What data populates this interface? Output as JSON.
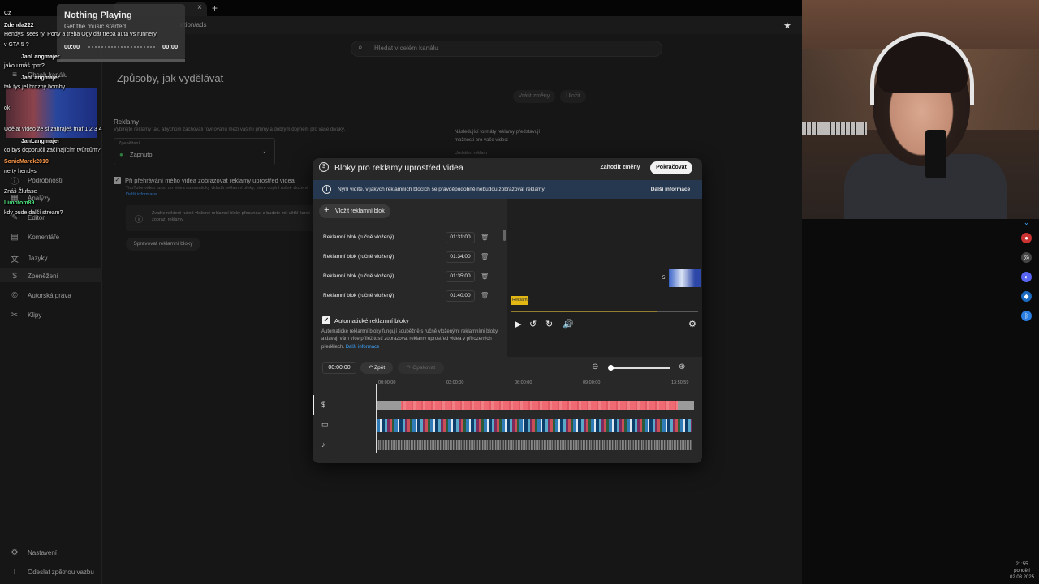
{
  "browser": {
    "tab_close": "×",
    "tab_new": "+",
    "url_fragment": "ation/ads",
    "star": "★"
  },
  "studio": {
    "search_placeholder": "Hledat v celém kanálu",
    "page_title": "Způsoby, jak vydělávat",
    "cancel_label": "Vrátit změny",
    "save_label": "Uložit",
    "ads_heading": "Reklamy",
    "ads_desc": "Vybírejte reklamy tak, abychom zachovali rovnováhu mezi vašimi příjmy a dobrým dojmem pro vaše diváky.",
    "ads_select_label": "Zpeněžení",
    "ads_select_value": "Zapnuto",
    "midroll_label": "Při přehrávání mého videa zobrazovat reklamy uprostřed videa",
    "midroll_desc": "YouTube video turbo do videa automaticky vkládá reklamní bloky, které doplní ručně vložené",
    "midroll_more": "Další informace",
    "notice_text": "Zvažte některé ručně vložené reklamní bloky přesunout a budete mít větší šanci zobrazí reklamy",
    "manage_label": "Spravovat reklamní bloky",
    "right_info_text": "Následující formáty reklamy představují možnosti pro vaše video:",
    "right_info_sub": "Umístění reklam",
    "sidebar": [
      {
        "icon": "≡",
        "label": "Obsah kanálu"
      },
      {
        "icon": "ⓘ",
        "label": "Podrobnosti"
      },
      {
        "icon": "▦",
        "label": "Analýzy"
      },
      {
        "icon": "✎",
        "label": "Editor"
      },
      {
        "icon": "▤",
        "label": "Komentáře"
      },
      {
        "icon": "文",
        "label": "Jazyky"
      },
      {
        "icon": "$",
        "label": "Zpeněžení"
      },
      {
        "icon": "©",
        "label": "Autorská práva"
      },
      {
        "icon": "✂",
        "label": "Klipy"
      },
      {
        "icon": "⚙",
        "label": "Nastavení"
      },
      {
        "icon": "!",
        "label": "Odeslat zpětnou vazbu"
      }
    ]
  },
  "now_playing": {
    "title": "Nothing Playing",
    "subtitle": "Get the music started",
    "time_start": "00:00",
    "time_end": "00:00"
  },
  "chat": [
    {
      "text": "Cz"
    },
    {
      "text": "Zdenda222"
    },
    {
      "text": "Hendys: sees ty. Porty a treba Ogy dát treba auta vs runnery"
    },
    {
      "text": "v GTA 5 ?"
    },
    {
      "text": "JanLangmajer"
    },
    {
      "text": "jakou máš rpm?"
    },
    {
      "text": "JanLangmajer"
    },
    {
      "text": "tak tys jel hrozný bomby"
    },
    {
      "text": "ok"
    },
    {
      "text": "Udělat video že si zahraješ fnaf 1 2 3 4"
    },
    {
      "text": "JanLangmajer"
    },
    {
      "text": "co bys doporučil začínajícím tvůrcům?"
    },
    {
      "text": "SonicMarek2010"
    },
    {
      "text": "ne ty hendys"
    },
    {
      "text": "Znáš Žlufase"
    },
    {
      "text": "Limotom89"
    },
    {
      "text": "kdy bude další stream?"
    }
  ],
  "modal": {
    "title": "Bloky pro reklamy uprostřed videa",
    "discard_label": "Zahodit změny",
    "continue_label": "Pokračovat",
    "info_text": "Nyní vidíte, v jakých reklamních blocích se pravděpodobně nebudou zobrazovat reklamy",
    "info_more": "Další informace",
    "insert_label": "Vložit reklamní blok",
    "rows": [
      {
        "label": "Reklamní blok (ručně vložený)",
        "time": "01:31:00"
      },
      {
        "label": "Reklamní blok (ručně vložený)",
        "time": "01:34:00"
      },
      {
        "label": "Reklamní blok (ručně vložený)",
        "time": "01:35:00"
      },
      {
        "label": "Reklamní blok (ručně vložený)",
        "time": "01:40:00"
      }
    ],
    "auto_label": "Automatické reklamní bloky",
    "auto_desc": "Automatické reklamní bloky fungují souběžně s ručně vloženými reklamními bloky a dávají vám více příležitostí zobrazovat reklamy uprostřed videa v přirozených předělech.",
    "auto_more": "Další informace",
    "preview_count": "5",
    "preview_marker": "Reklama",
    "timecode": "00:00:00",
    "undo_label": "Zpět",
    "redo_label": "Opakovat",
    "ticks": [
      "00:00:00",
      "03:00:00",
      "06:00:00",
      "09:00:00",
      "13:50:59"
    ]
  },
  "clock": {
    "time": "21:55",
    "day": "pondělí",
    "date": "02.03.2025"
  },
  "colors": {
    "accent_blue": "#3ea6ff",
    "ad_track": "#f06a73",
    "marker": "#e2b714"
  }
}
